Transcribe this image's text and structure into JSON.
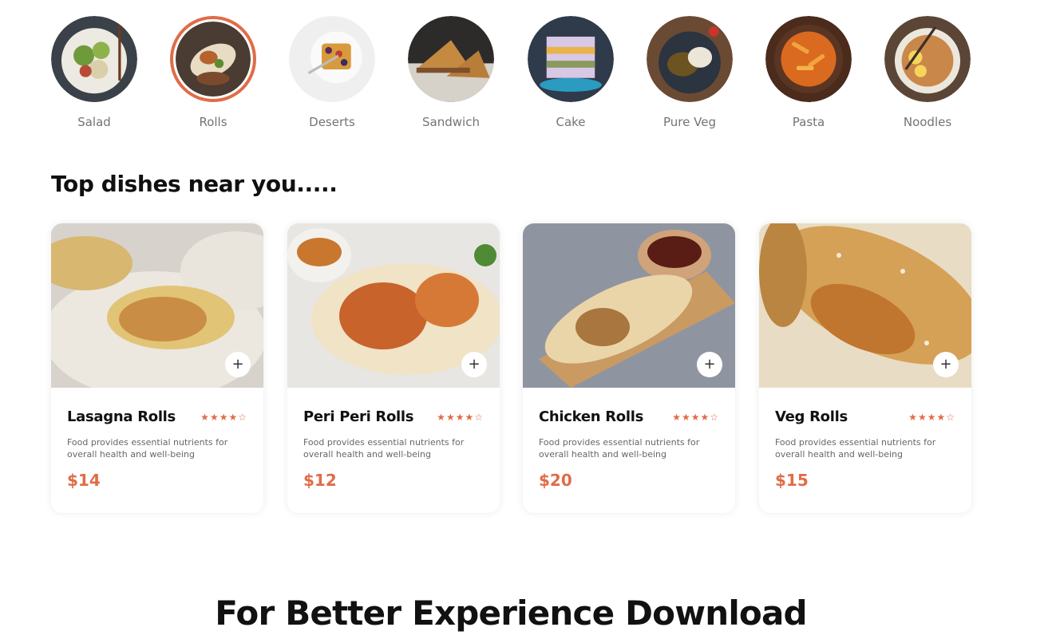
{
  "categories": {
    "active": "Rolls",
    "items": [
      {
        "label": "Salad"
      },
      {
        "label": "Rolls"
      },
      {
        "label": "Deserts"
      },
      {
        "label": "Sandwich"
      },
      {
        "label": "Cake"
      },
      {
        "label": "Pure Veg"
      },
      {
        "label": "Pasta"
      },
      {
        "label": "Noodles"
      }
    ]
  },
  "section": {
    "title": "Top dishes near you....."
  },
  "dishes": [
    {
      "name": "Lasagna Rolls",
      "description": "Food provides essential nutrients for overall health and well-being",
      "price": "$14",
      "rating": 4,
      "add": "+"
    },
    {
      "name": "Peri Peri Rolls",
      "description": "Food provides essential nutrients for overall health and well-being",
      "price": "$12",
      "rating": 4,
      "add": "+"
    },
    {
      "name": "Chicken Rolls",
      "description": "Food provides essential nutrients for overall health and well-being",
      "price": "$20",
      "rating": 4,
      "add": "+"
    },
    {
      "name": "Veg Rolls",
      "description": "Food provides essential nutrients for overall health and well-being",
      "price": "$15",
      "rating": 4,
      "add": "+"
    }
  ],
  "download": {
    "title": "For Better Experience Download"
  },
  "colors": {
    "accent": "#e06c48",
    "heading": "#101010",
    "muted": "#747474"
  },
  "icons": {
    "add": "plus-icon",
    "star": "star-icon"
  }
}
